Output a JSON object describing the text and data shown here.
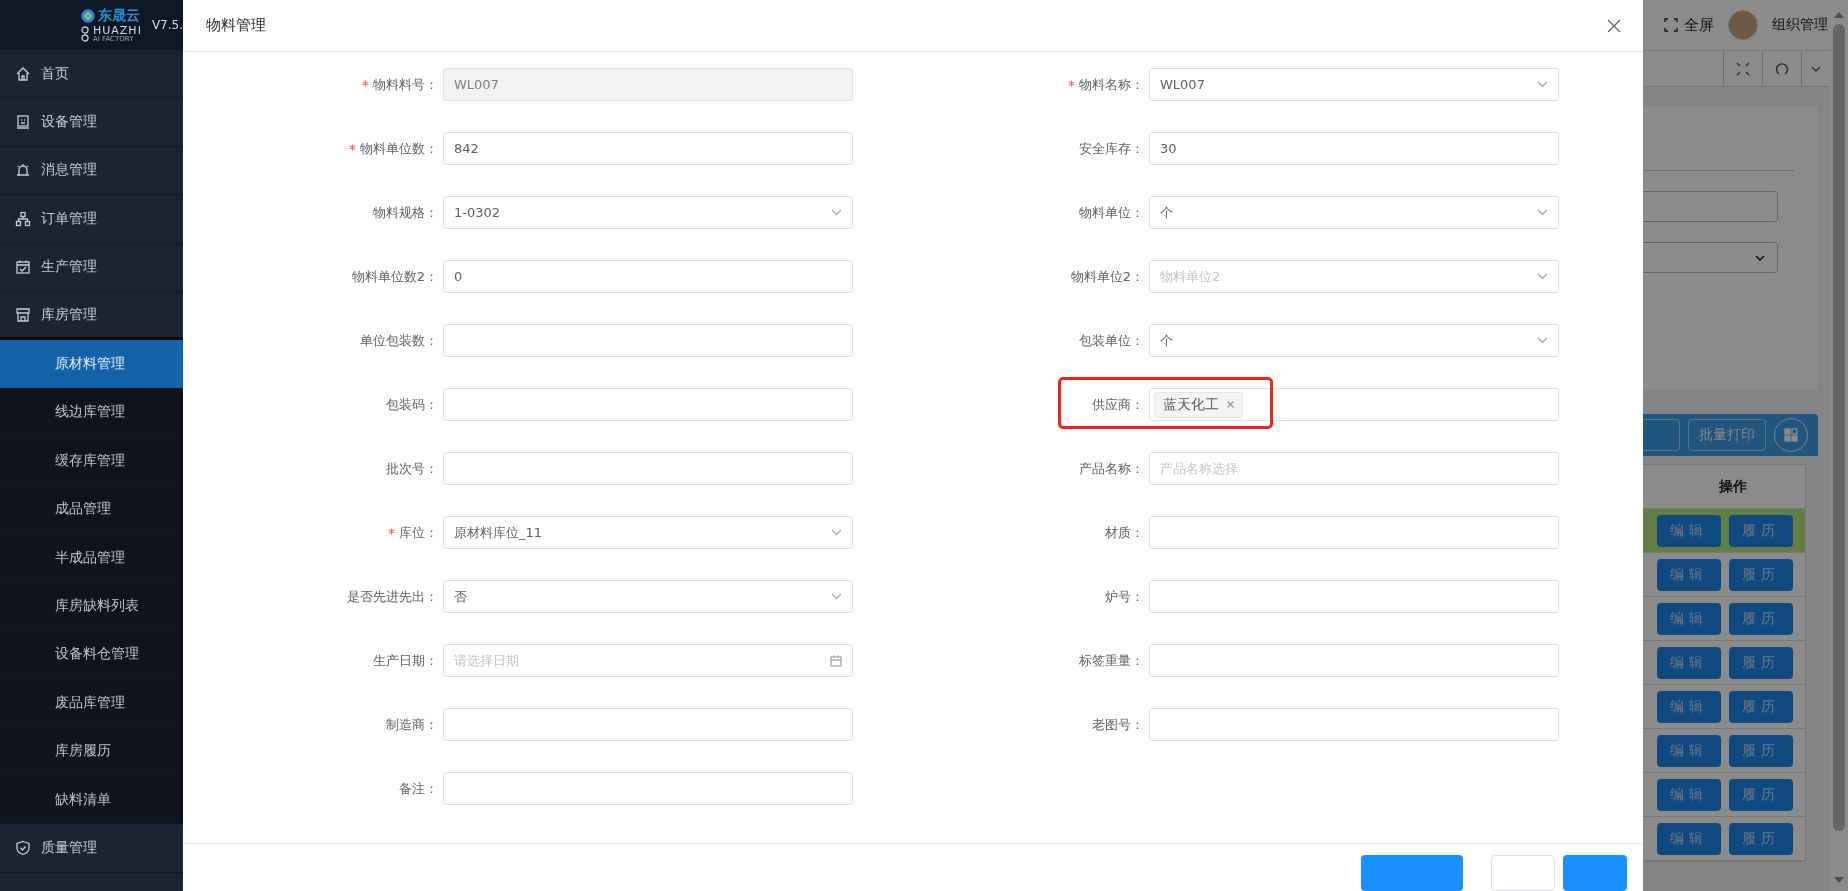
{
  "sidebar": {
    "logo": {
      "brand": "东晟云",
      "name": "HUAZHI",
      "tagline": "AI FACTORY"
    },
    "version": "V7.5.",
    "items": [
      {
        "label": "首页",
        "selected": false,
        "expanded": false
      },
      {
        "label": "设备管理",
        "selected": false,
        "expanded": false
      },
      {
        "label": "消息管理",
        "selected": false,
        "expanded": false
      },
      {
        "label": "订单管理",
        "selected": false,
        "expanded": false
      },
      {
        "label": "生产管理",
        "selected": false,
        "expanded": false
      },
      {
        "label": "库房管理",
        "selected": false,
        "expanded": true,
        "children": [
          {
            "label": "原材料管理",
            "selected": true
          },
          {
            "label": "线边库管理",
            "selected": false
          },
          {
            "label": "缓存库管理",
            "selected": false
          },
          {
            "label": "成品管理",
            "selected": false
          },
          {
            "label": "半成品管理",
            "selected": false
          },
          {
            "label": "库房缺料列表",
            "selected": false
          },
          {
            "label": "设备料仓管理",
            "selected": false
          },
          {
            "label": "废品库管理",
            "selected": false
          },
          {
            "label": "库房履历",
            "selected": false
          },
          {
            "label": "缺料清单",
            "selected": false
          }
        ]
      },
      {
        "label": "质量管理",
        "selected": false,
        "expanded": false
      }
    ]
  },
  "header": {
    "fullscreen": "全屏",
    "user": "组织管理"
  },
  "table": {
    "print_button": "批量打印",
    "columns": [
      "操作"
    ],
    "rows": [
      {
        "highlighted": true,
        "actions": [
          "编辑",
          "履历"
        ]
      },
      {
        "highlighted": false,
        "actions": [
          "编辑",
          "履历"
        ]
      },
      {
        "highlighted": false,
        "actions": [
          "编辑",
          "履历"
        ]
      },
      {
        "highlighted": false,
        "actions": [
          "编辑",
          "履历"
        ]
      },
      {
        "highlighted": false,
        "actions": [
          "编辑",
          "履历"
        ]
      },
      {
        "highlighted": false,
        "actions": [
          "编辑",
          "履历"
        ]
      },
      {
        "highlighted": false,
        "actions": [
          "编辑",
          "履历"
        ]
      },
      {
        "highlighted": false,
        "actions": [
          "编辑",
          "履历"
        ]
      }
    ]
  },
  "modal": {
    "title": "物料管理",
    "fields": [
      {
        "label": "物料料号：",
        "required": true,
        "kind": "text",
        "value": "WL007",
        "disabled": true,
        "highlighted": false
      },
      {
        "label": "物料名称：",
        "required": true,
        "kind": "select",
        "value": "WL007",
        "disabled": false,
        "highlighted": false
      },
      {
        "label": "物料单位数：",
        "required": true,
        "kind": "text",
        "value": "842",
        "disabled": false,
        "highlighted": false
      },
      {
        "label": "安全库存：",
        "required": false,
        "kind": "text",
        "value": "30",
        "disabled": false,
        "highlighted": false
      },
      {
        "label": "物料规格：",
        "required": false,
        "kind": "select",
        "value": "1-0302",
        "disabled": false,
        "highlighted": false
      },
      {
        "label": "物料单位：",
        "required": false,
        "kind": "select",
        "value": "个",
        "disabled": false,
        "highlighted": false
      },
      {
        "label": "物料单位数2：",
        "required": false,
        "kind": "text",
        "value": "0",
        "disabled": false,
        "highlighted": false
      },
      {
        "label": "物料单位2：",
        "required": false,
        "kind": "select",
        "placeholder": "物料单位2",
        "disabled": false,
        "highlighted": false
      },
      {
        "label": "单位包装数：",
        "required": false,
        "kind": "text",
        "disabled": false,
        "highlighted": false
      },
      {
        "label": "包装单位：",
        "required": false,
        "kind": "select",
        "value": "个",
        "disabled": false,
        "highlighted": false
      },
      {
        "label": "包装码：",
        "required": false,
        "kind": "text",
        "disabled": false,
        "highlighted": false
      },
      {
        "label": "供应商：",
        "required": false,
        "kind": "tags",
        "tags": [
          "蓝天化工"
        ],
        "disabled": false,
        "highlighted": true
      },
      {
        "label": "批次号：",
        "required": false,
        "kind": "text",
        "disabled": false,
        "highlighted": false
      },
      {
        "label": "产品名称：",
        "required": false,
        "kind": "text",
        "placeholder": "产品名称选择",
        "disabled": false,
        "highlighted": false
      },
      {
        "label": "库位：",
        "required": true,
        "kind": "select",
        "value": "原材料库位_11",
        "disabled": false,
        "highlighted": false
      },
      {
        "label": "材质：",
        "required": false,
        "kind": "text",
        "disabled": false,
        "highlighted": false
      },
      {
        "label": "是否先进先出：",
        "required": false,
        "kind": "select",
        "value": "否",
        "disabled": false,
        "highlighted": false
      },
      {
        "label": "炉号：",
        "required": false,
        "kind": "text",
        "disabled": false,
        "highlighted": false
      },
      {
        "label": "生产日期：",
        "required": false,
        "kind": "date",
        "placeholder": "请选择日期",
        "disabled": false,
        "highlighted": false
      },
      {
        "label": "标签重量：",
        "required": false,
        "kind": "text",
        "disabled": false,
        "highlighted": false
      },
      {
        "label": "制造商：",
        "required": false,
        "kind": "text",
        "disabled": false,
        "highlighted": false
      },
      {
        "label": "老图号：",
        "required": false,
        "kind": "text",
        "disabled": false,
        "highlighted": false
      },
      {
        "label": "备注：",
        "required": false,
        "kind": "text",
        "disabled": false,
        "highlighted": false
      }
    ]
  }
}
